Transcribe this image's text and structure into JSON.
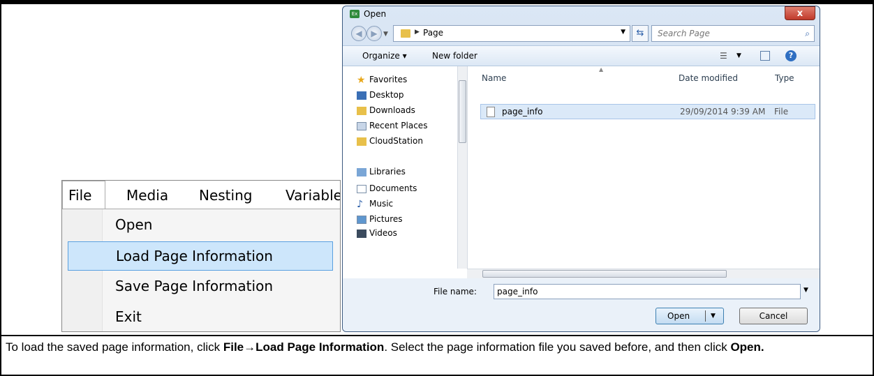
{
  "menu": {
    "bar": [
      "File",
      "Media",
      "Nesting",
      "Variable"
    ],
    "items": [
      "Open",
      "Load Page Information",
      "Save Page Information",
      "Exit"
    ]
  },
  "dialog": {
    "title": "Open",
    "close_label": "x",
    "address": "Page",
    "search_placeholder": "Search Page",
    "toolbar": {
      "organize": "Organize ▾",
      "new_folder": "New folder"
    },
    "nav": {
      "favorites_header": "Favorites",
      "favorites": [
        "Desktop",
        "Downloads",
        "Recent Places",
        "CloudStation"
      ],
      "libraries_header": "Libraries",
      "libraries": [
        "Documents",
        "Music",
        "Pictures",
        "Videos"
      ]
    },
    "columns": {
      "name": "Name",
      "date": "Date modified",
      "type": "Type"
    },
    "file": {
      "name": "page_info",
      "date": "29/09/2014 9:39 AM",
      "type": "File"
    },
    "file_name_label": "File name:",
    "file_name_value": "page_info",
    "open_label": "Open",
    "cancel_label": "Cancel"
  },
  "caption": {
    "part1": "To load the saved page information, click ",
    "bold1": "File→Load Page Information",
    "part2": ". Select the page information file you saved before, and then click ",
    "bold2": "Open."
  }
}
